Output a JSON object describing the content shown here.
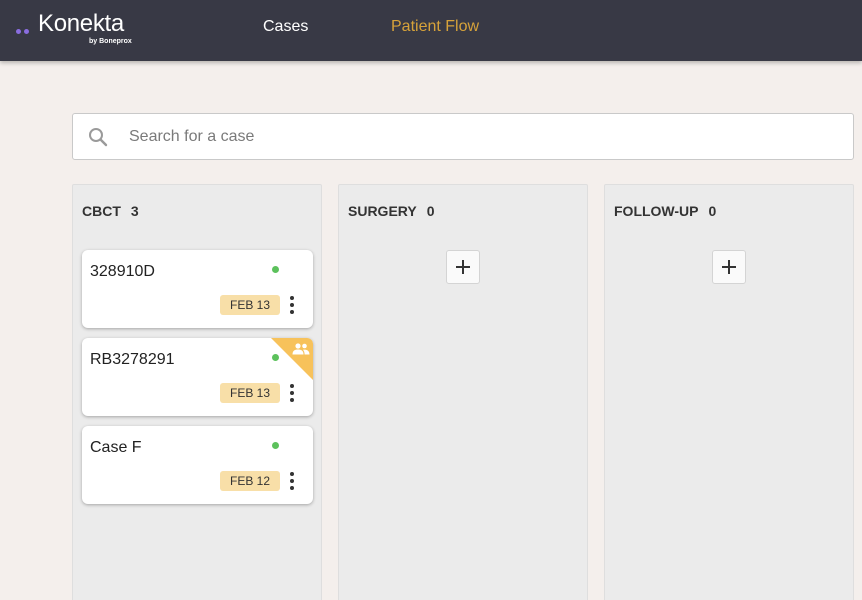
{
  "app": {
    "logo_name": "Konekta",
    "logo_sub": "by Boneprox",
    "brand_color": "#8a6de0"
  },
  "nav": {
    "cases": "Cases",
    "patient_flow": "Patient Flow",
    "active": "Patient Flow",
    "active_color": "#d6a23a"
  },
  "search": {
    "placeholder": "Search for a case",
    "value": "",
    "icon": "search-icon"
  },
  "columns": [
    {
      "title": "CBCT",
      "count": "3",
      "cards": [
        {
          "title": "328910D",
          "date": "FEB 13",
          "status_color": "#5cc15c",
          "shared": false
        },
        {
          "title": "RB3278291",
          "date": "FEB 13",
          "status_color": "#5cc15c",
          "shared": true,
          "shared_icon": "group-icon"
        },
        {
          "title": "Case F",
          "date": "FEB 12",
          "status_color": "#5cc15c",
          "shared": false
        }
      ]
    },
    {
      "title": "SURGERY",
      "count": "0",
      "add_icon": "plus-icon",
      "cards": []
    },
    {
      "title": "FOLLOW-UP",
      "count": "0",
      "add_icon": "plus-icon",
      "cards": []
    }
  ]
}
